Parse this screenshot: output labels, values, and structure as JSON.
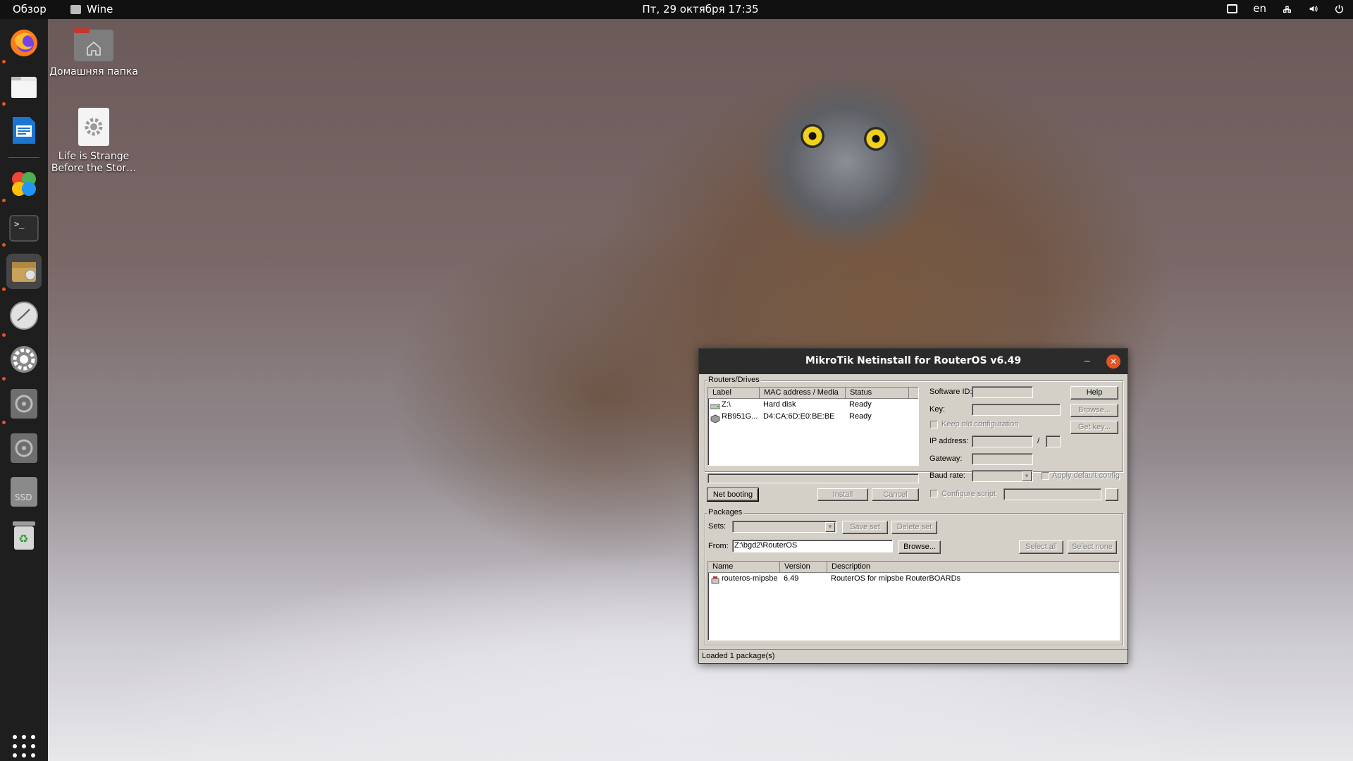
{
  "topbar": {
    "activities": "Обзор",
    "app_name": "Wine",
    "clock": "Пт, 29 октября  17:35",
    "language": "en"
  },
  "dock": {
    "items": [
      "firefox-icon",
      "files-icon",
      "writer-icon",
      "photos-icon",
      "terminal-icon",
      "wine-icon",
      "disk-tool-icon",
      "settings-icon",
      "cd-drive-icon",
      "cd-drive-icon",
      "ssd-drive-icon",
      "trash-icon"
    ]
  },
  "desktop": {
    "home_folder": "Домашняя папка",
    "game_shortcut": "Life is Strange Before the Stor…"
  },
  "window": {
    "title": "MikroTik Netinstall for RouterOS v6.49",
    "routers": {
      "group_label": "Routers/Drives",
      "columns": [
        "Label",
        "MAC address / Media",
        "Status"
      ],
      "rows": [
        {
          "label": "Z:\\",
          "media": "Hard disk",
          "status": "Ready"
        },
        {
          "label": "RB951G...",
          "media": "D4:CA:6D:E0:BE:BE",
          "status": "Ready"
        }
      ],
      "net_booting": "Net booting",
      "install": "Install",
      "cancel": "Cancel"
    },
    "settings": {
      "software_id": "Software ID:",
      "help": "Help",
      "key": "Key:",
      "browse": "Browse...",
      "keep_old": "Keep old configuration",
      "get_key": "Get key...",
      "ip_address": "IP address:",
      "slash": "/",
      "gateway": "Gateway:",
      "baud_rate": "Baud rate:",
      "apply_default": "Apply default config",
      "configure_script": "Configure script"
    },
    "packages": {
      "group_label": "Packages",
      "sets": "Sets:",
      "save_set": "Save set",
      "delete_set": "Delete set",
      "from": "From:",
      "from_value": "Z:\\bgd2\\RouterOS",
      "browse": "Browse...",
      "select_all": "Select all",
      "select_none": "Select none",
      "columns": [
        "Name",
        "Version",
        "Description"
      ],
      "rows": [
        {
          "name": "routeros-mipsbe",
          "version": "6.49",
          "description": "RouterOS for mipsbe RouterBOARDs"
        }
      ]
    },
    "status": "Loaded 1 package(s)"
  }
}
